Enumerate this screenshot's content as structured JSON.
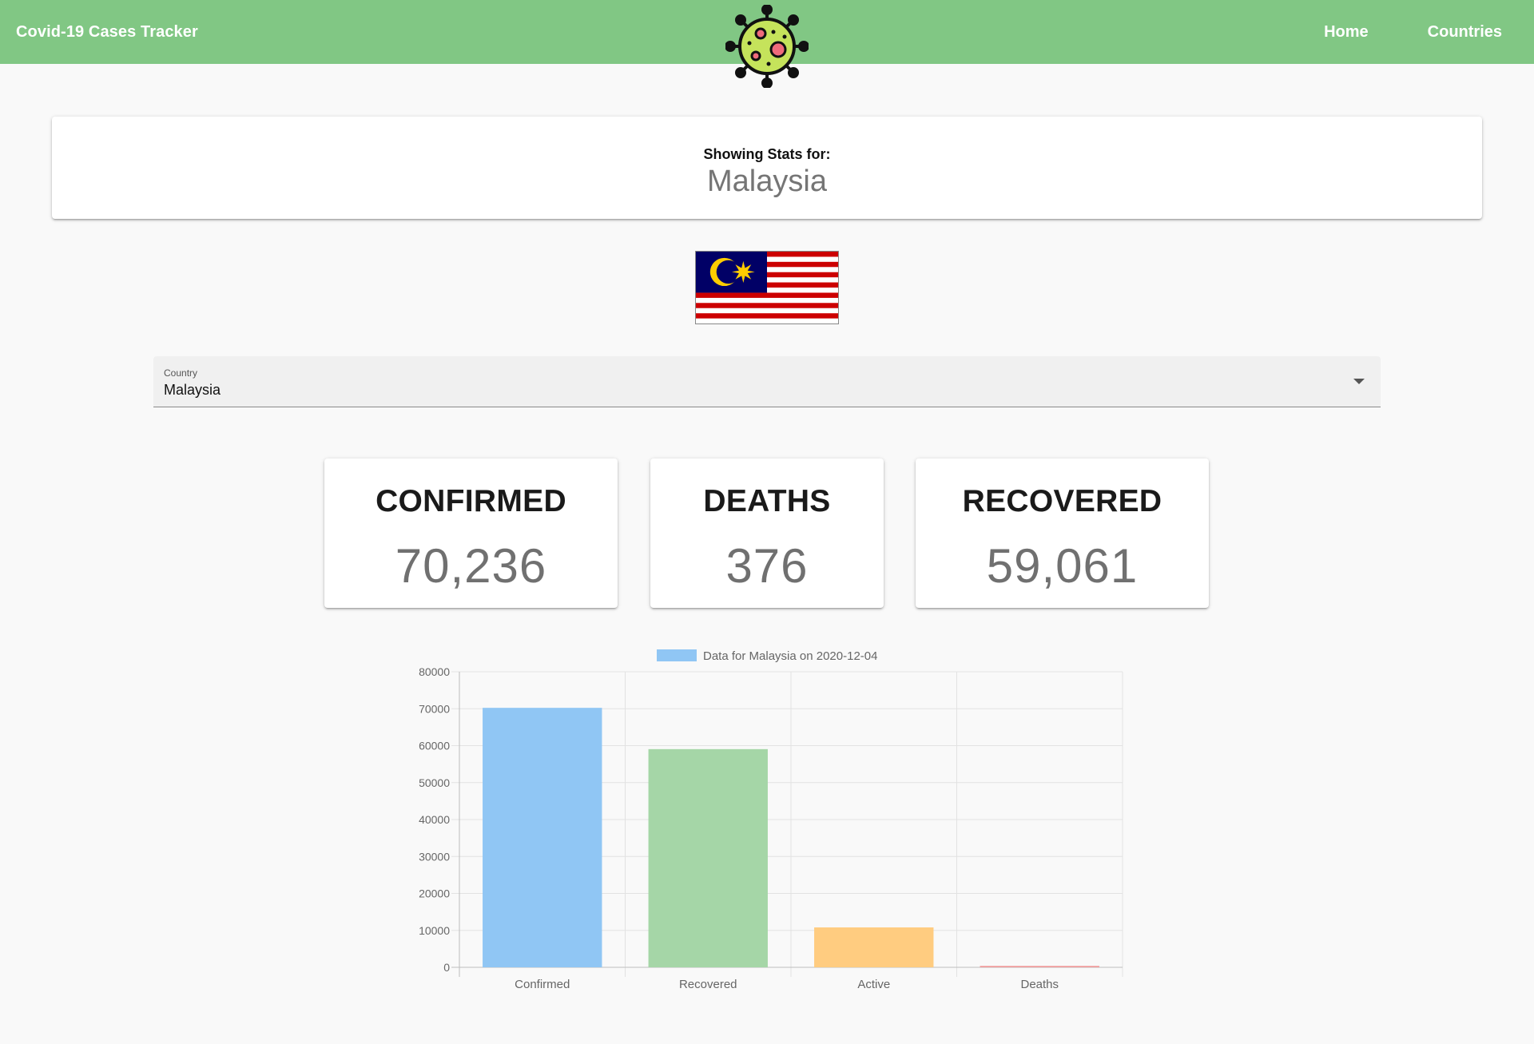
{
  "header": {
    "title": "Covid-19 Cases Tracker",
    "nav": [
      {
        "label": "Home"
      },
      {
        "label": "Countries"
      }
    ],
    "logo_icon": "virus-icon"
  },
  "showing": {
    "label": "Showing Stats for:",
    "country": "Malaysia"
  },
  "flag": {
    "icon": "malaysia-flag-icon"
  },
  "country_select": {
    "label": "Country",
    "value": "Malaysia"
  },
  "stats": [
    {
      "title": "CONFIRMED",
      "value": "70,236"
    },
    {
      "title": "DEATHS",
      "value": "376"
    },
    {
      "title": "RECOVERED",
      "value": "59,061"
    }
  ],
  "colors": {
    "header_bg": "#81c784",
    "confirmed_bar": "#90c6f4",
    "recovered_bar": "#a5d6a7",
    "active_bar": "#ffcc80",
    "deaths_bar": "#ef9a9a"
  },
  "chart_data": {
    "type": "bar",
    "legend": "Data for Malaysia on 2020-12-04",
    "legend_position": "top",
    "categories": [
      "Confirmed",
      "Recovered",
      "Active",
      "Deaths"
    ],
    "values": [
      70236,
      59061,
      10799,
      376
    ],
    "bar_colors": [
      "#90c6f4",
      "#a5d6a7",
      "#ffcc80",
      "#ef9a9a"
    ],
    "ylim": [
      0,
      80000
    ],
    "yticks": [
      0,
      10000,
      20000,
      30000,
      40000,
      50000,
      60000,
      70000,
      80000
    ],
    "grid": true
  }
}
